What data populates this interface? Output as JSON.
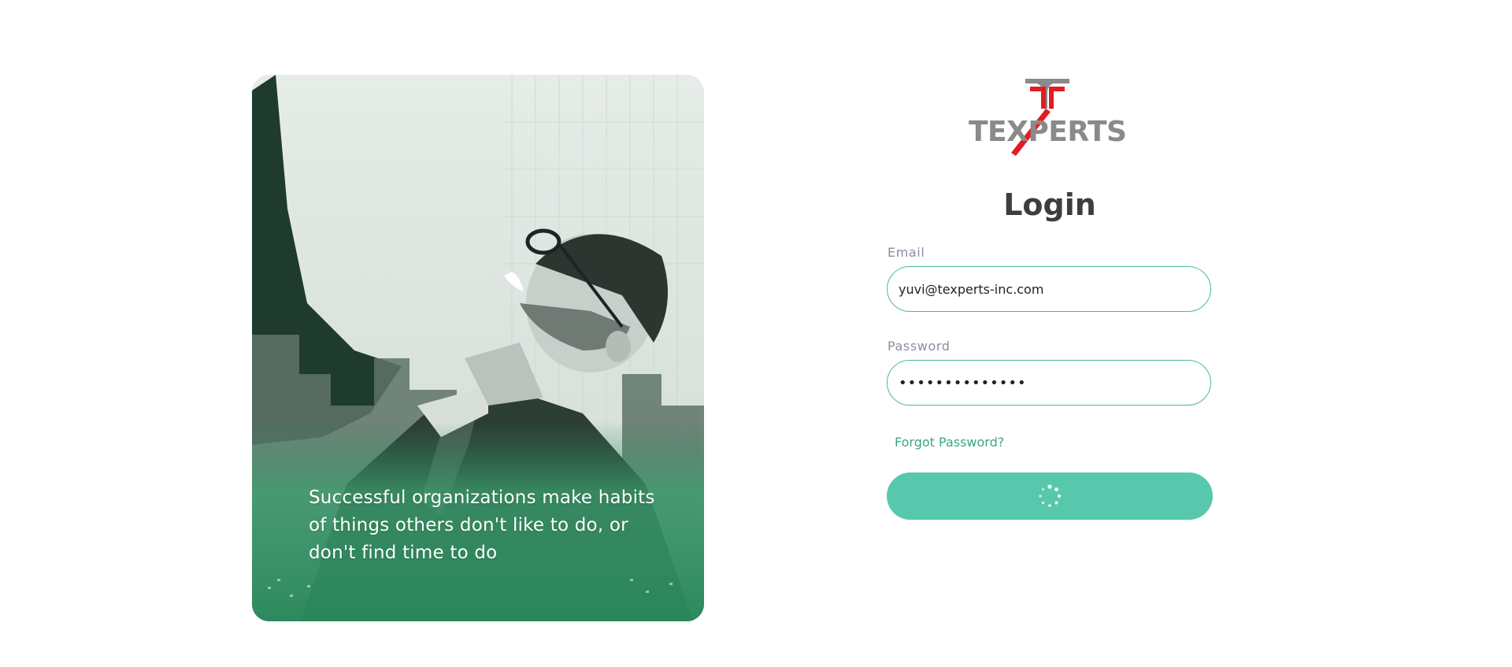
{
  "hero": {
    "quote": "Successful organizations make habits of things others  don't like to do, or don't find time to do"
  },
  "brand": {
    "logo_text": "TEXPERTS",
    "accent_red": "#e31b23",
    "logo_gray": "#8a8a8a"
  },
  "login": {
    "title": "Login",
    "email_label": "Email",
    "email_value": "yuvi@texperts-inc.com",
    "password_label": "Password",
    "password_value": "••••••••••••••",
    "forgot_password": "Forgot Password?",
    "submit_state": "loading",
    "submit_icon": "spinner-icon"
  },
  "colors": {
    "accent": "#58c8ad",
    "input_border": "#4db896",
    "link": "#3aa881",
    "label": "#8c8ca3",
    "title": "#3d3d3d"
  }
}
